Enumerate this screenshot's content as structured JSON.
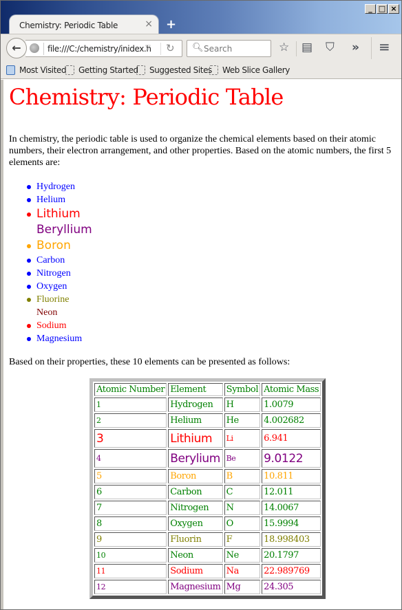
{
  "browser": {
    "tab_title": "Chemistry: Periodic Table",
    "tab_close": "×",
    "new_tab": "+",
    "url": "file:///C:/chemistry/inidex.h",
    "search_placeholder": "Search",
    "window_controls": {
      "minimize": "_",
      "maximize": "□",
      "close": "×"
    },
    "icons": {
      "back": "←",
      "reload": "↻",
      "dropdown": "▽",
      "search": "⚲",
      "bookmark_star": "☆",
      "reading_list": "▤",
      "pocket": "⛉",
      "overflow": "»",
      "menu": "≡"
    },
    "bookmarks": [
      "Most Visited",
      "Getting Started",
      "Suggested Sites",
      "Web Slice Gallery"
    ]
  },
  "page": {
    "title": "Chemistry: Periodic Table",
    "intro": "In chemistry, the periodic table is used to organize the chemical elements based on their atomic numbers, their electron arrangement, and other properties. Based on the atomic numbers, the first 5 elements are:",
    "list": [
      {
        "name": "Hydrogen",
        "color": "#0000ff",
        "bullet": true,
        "big": false
      },
      {
        "name": "Helium",
        "color": "#0000ff",
        "bullet": true,
        "big": false
      },
      {
        "name": "Lithium",
        "color": "#ff0000",
        "bullet": true,
        "big": true
      },
      {
        "name": "Beryllium",
        "color": "#800080",
        "bullet": false,
        "big": true
      },
      {
        "name": "Boron",
        "color": "#ffa500",
        "bullet": true,
        "big": true
      },
      {
        "name": "Carbon",
        "color": "#0000ff",
        "bullet": true,
        "big": false
      },
      {
        "name": "Nitrogen",
        "color": "#0000ff",
        "bullet": true,
        "big": false
      },
      {
        "name": "Oxygen",
        "color": "#0000ff",
        "bullet": true,
        "big": false
      },
      {
        "name": "Fluorine",
        "color": "#808000",
        "bullet": true,
        "big": false
      },
      {
        "name": "Neon",
        "color": "#800000",
        "bullet": false,
        "big": false
      },
      {
        "name": "Sodium",
        "color": "#ff0000",
        "bullet": true,
        "big": false
      },
      {
        "name": "Magnesium",
        "color": "#0000ff",
        "bullet": true,
        "big": false
      }
    ],
    "outro": "Based on their properties, these 10 elements can be presented as follows:",
    "table": {
      "header_color": "#008000",
      "headers": [
        "Atomic Number",
        "Element",
        "Symbol",
        "Atomic Mass"
      ],
      "rows": [
        {
          "cells": [
            "1",
            "Hydrogen",
            "H",
            "1.0079"
          ],
          "color": "#008000",
          "styles": [
            "small",
            "",
            "",
            ""
          ]
        },
        {
          "cells": [
            "2",
            "Helium",
            "He",
            "4.002682"
          ],
          "color": "#008000",
          "styles": [
            "small",
            "",
            "",
            ""
          ]
        },
        {
          "cells": [
            "3",
            "Lithium",
            "Li",
            "6.941"
          ],
          "color": "#ff0000",
          "styles": [
            "big",
            "big",
            "small",
            ""
          ]
        },
        {
          "cells": [
            "4",
            "Berylium",
            "Be",
            "9.0122"
          ],
          "color": "#800080",
          "styles": [
            "small",
            "big",
            "small",
            "big"
          ]
        },
        {
          "cells": [
            "5",
            "Boron",
            "B",
            "10.811"
          ],
          "color": "#ffa500",
          "styles": [
            "",
            "",
            "",
            ""
          ]
        },
        {
          "cells": [
            "6",
            "Carbon",
            "C",
            "12.011"
          ],
          "color": "#008000",
          "styles": [
            "",
            "",
            "",
            ""
          ]
        },
        {
          "cells": [
            "7",
            "Nitrogen",
            "N",
            "14.0067"
          ],
          "color": "#008000",
          "styles": [
            "",
            "",
            "",
            ""
          ]
        },
        {
          "cells": [
            "8",
            "Oxygen",
            "O",
            "15.9994"
          ],
          "color": "#008000",
          "styles": [
            "",
            "",
            "",
            ""
          ]
        },
        {
          "cells": [
            "9",
            "Fluorin",
            "F",
            "18.998403"
          ],
          "color": "#808000",
          "styles": [
            "",
            "",
            "",
            ""
          ]
        },
        {
          "cells": [
            "10",
            "Neon",
            "Ne",
            "20.1797"
          ],
          "color": "#008000",
          "styles": [
            "small",
            "",
            "",
            ""
          ]
        },
        {
          "cells": [
            "11",
            "Sodium",
            "Na",
            "22.989769"
          ],
          "color": "#ff0000",
          "styles": [
            "small",
            "",
            "",
            ""
          ]
        },
        {
          "cells": [
            "12",
            "Magnesium",
            "Mg",
            "24.305"
          ],
          "color": "#800080",
          "styles": [
            "small",
            "",
            "",
            ""
          ]
        }
      ]
    }
  }
}
